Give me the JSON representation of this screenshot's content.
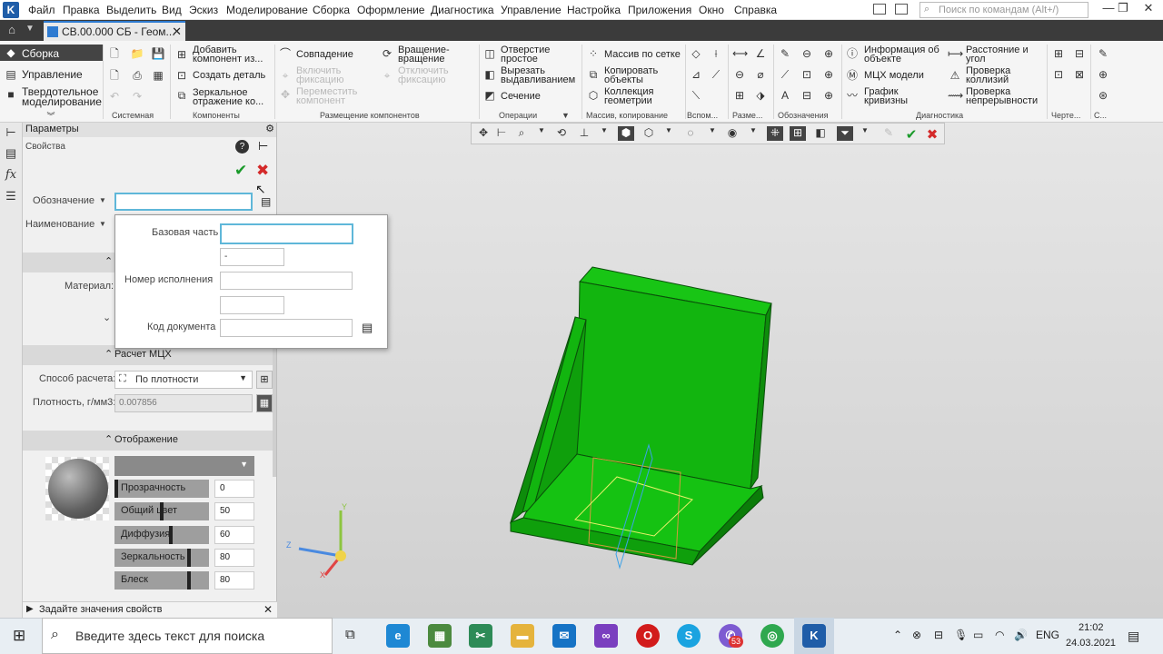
{
  "menu": {
    "items": [
      "Файл",
      "Правка",
      "Выделить",
      "Вид",
      "Эскиз",
      "Моделирование",
      "Сборка",
      "Оформление",
      "Диагностика",
      "Управление",
      "Настройка",
      "Приложения",
      "Окно",
      "Справка"
    ],
    "search_placeholder": "Поиск по командам (Alt+/)"
  },
  "tab": {
    "title": "СВ.00.000 СБ - Геом..."
  },
  "ribbon": {
    "side": {
      "sborka": "Сборка",
      "upravlenie": "Управление",
      "tverdotel1": "Твердотельное",
      "tverdotel2": "моделирование"
    },
    "groups": [
      "Системная",
      "Компоненты",
      "Размещение компонентов",
      "Операции",
      "Массив, копирование",
      "Вспом...",
      "Разме...",
      "Обозначения",
      "Диагностика",
      "Черте...",
      "С..."
    ],
    "components": {
      "add1": "Добавить",
      "add2": "компонент из...",
      "create": "Создать деталь",
      "mirror1": "Зеркальное",
      "mirror2": "отражение ко..."
    },
    "placement": {
      "coincide": "Совпадение",
      "enable1": "Включить",
      "enable2": "фиксацию",
      "move1": "Переместить",
      "move2": "компонент",
      "rotate1": "Вращение-",
      "rotate2": "вращение",
      "disable1": "Отключить",
      "disable2": "фиксацию"
    },
    "operations": {
      "hole1": "Отверстие",
      "hole2": "простое",
      "cut1": "Вырезать",
      "cut2": "выдавливанием",
      "section": "Сечение"
    },
    "array": {
      "grid": "Массив по сетке",
      "copy1": "Копировать",
      "copy2": "объекты",
      "coll1": "Коллекция",
      "coll2": "геометрии"
    },
    "diagnostics": {
      "info1": "Информация об",
      "info2": "объекте",
      "mch": "МЦХ модели",
      "graph1": "График",
      "graph2": "кривизны",
      "dist1": "Расстояние и",
      "dist2": "угол",
      "coll1": "Проверка",
      "coll2": "коллизий",
      "cont1": "Проверка",
      "cont2": "непрерывности"
    }
  },
  "panel": {
    "title": "Параметры",
    "properties": "Свойства",
    "oboznachenie": "Обозначение",
    "naimenovanie": "Наименование",
    "material": "Материал:",
    "mch_section": "Расчет МЦХ",
    "method_label": "Способ расчета:",
    "method_value": "По плотности",
    "density_label": "Плотность, г/мм3:",
    "density_value": "0.007856",
    "display_section": "Отображение",
    "sliders": [
      {
        "label": "Прозрачность",
        "value": "0",
        "fraction": 0.0
      },
      {
        "label": "Общий цвет",
        "value": "50",
        "fraction": 0.5
      },
      {
        "label": "Диффузия",
        "value": "60",
        "fraction": 0.6
      },
      {
        "label": "Зеркальность",
        "value": "80",
        "fraction": 0.8
      },
      {
        "label": "Блеск",
        "value": "80",
        "fraction": 0.8
      }
    ],
    "status": "Задайте значения свойств"
  },
  "popup": {
    "base_label": "Базовая часть",
    "base_value": "",
    "dash_value": "-",
    "exec_label": "Номер исполнения",
    "exec_value": "",
    "extra_value": "",
    "code_label": "Код документа",
    "code_value": ""
  },
  "axes": {
    "y": "Y",
    "z": "Z",
    "x": "X"
  },
  "colors": {
    "model": "#11b10d",
    "accent": "#2e7bd1",
    "confirm": "#1a9a2a",
    "cancel": "#d42a2a"
  },
  "taskbar": {
    "search_placeholder": "Введите здесь текст для поиска",
    "lang": "ENG",
    "time": "21:02",
    "date": "24.03.2021",
    "badge": "53"
  }
}
